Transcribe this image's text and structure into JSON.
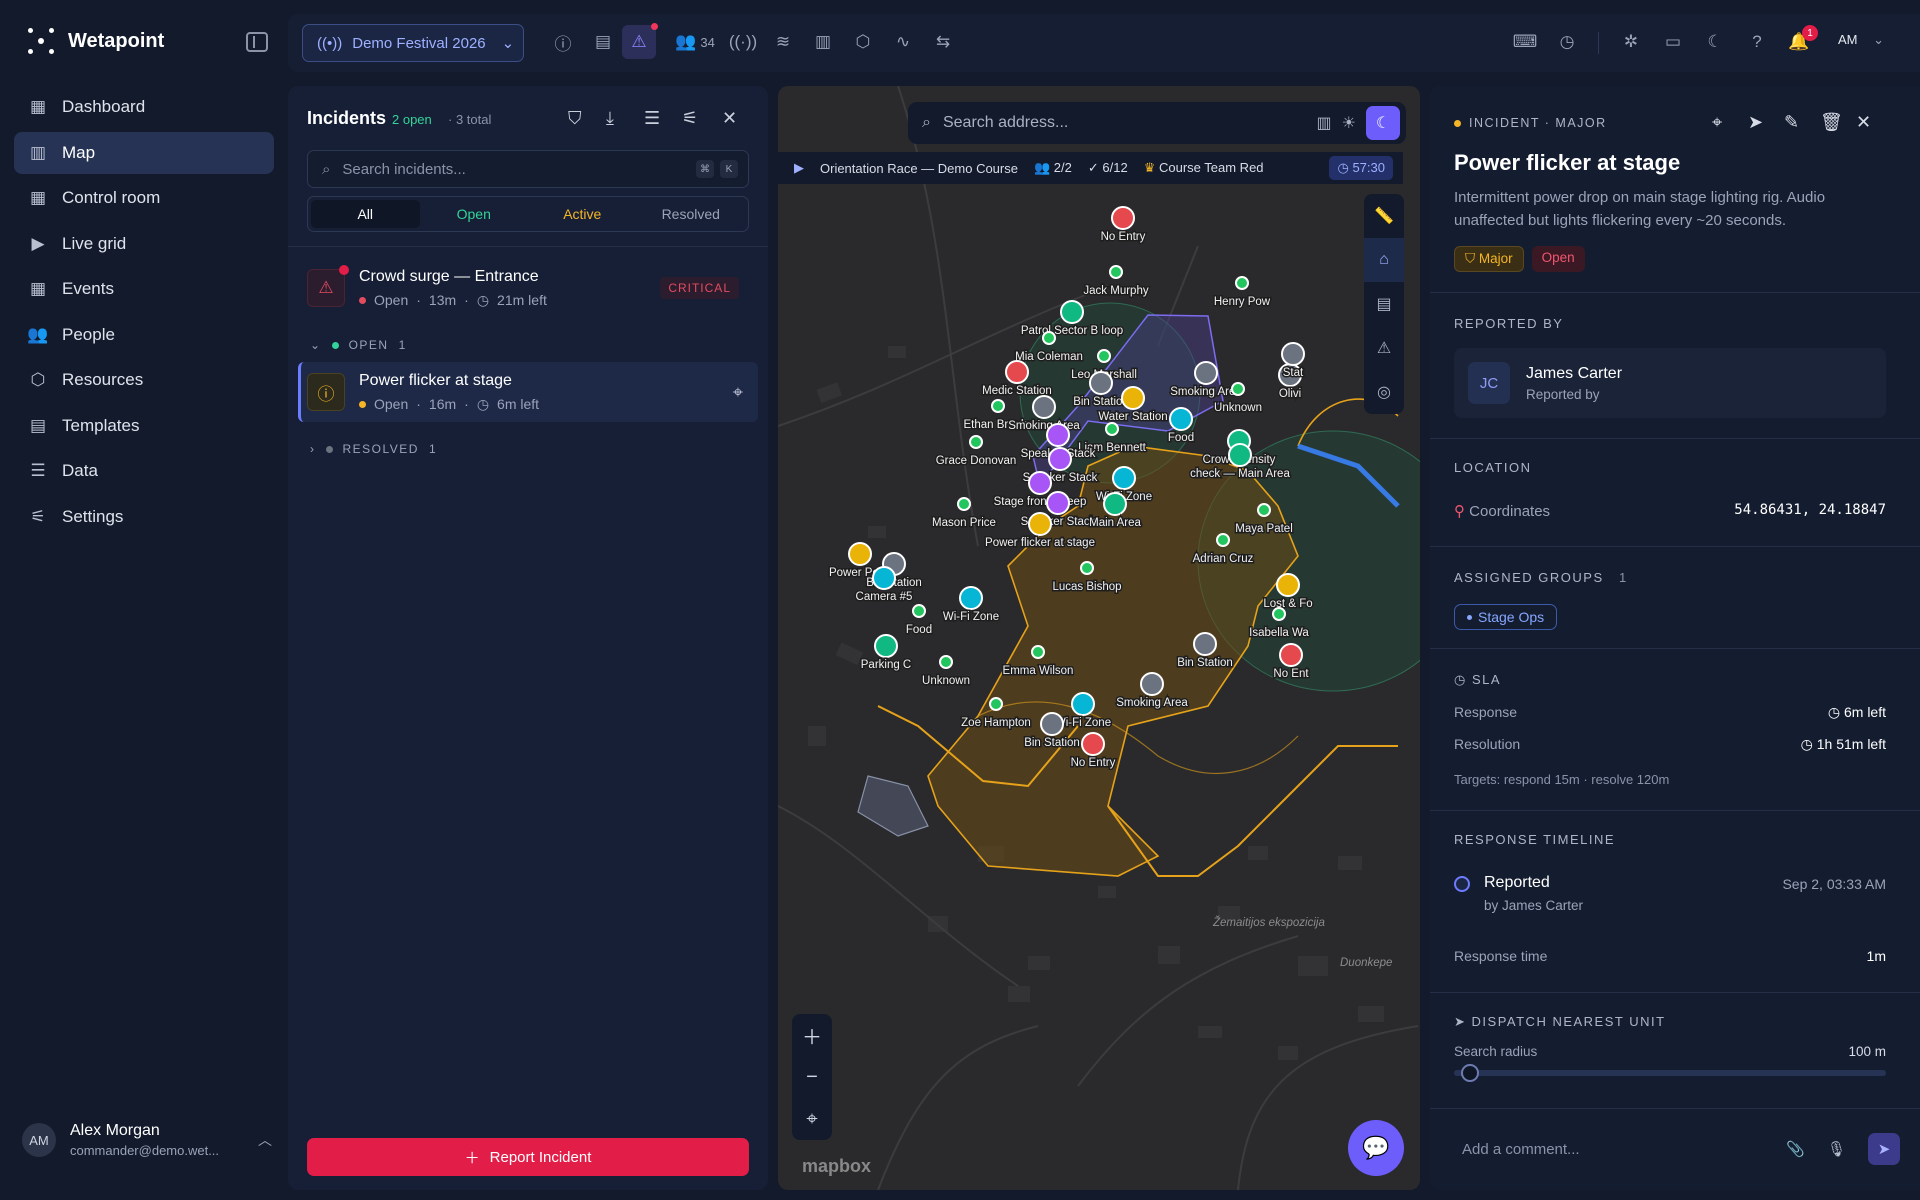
{
  "app": {
    "name": "Wetapoint"
  },
  "nav": [
    {
      "label": "Dashboard",
      "icon": "grid-icon"
    },
    {
      "label": "Map",
      "icon": "map-icon"
    },
    {
      "label": "Control room",
      "icon": "grid-icon"
    },
    {
      "label": "Live grid",
      "icon": "video-icon"
    },
    {
      "label": "Events",
      "icon": "calendar-icon"
    },
    {
      "label": "People",
      "icon": "users-icon"
    },
    {
      "label": "Resources",
      "icon": "box-icon"
    },
    {
      "label": "Templates",
      "icon": "clipboard-icon"
    },
    {
      "label": "Data",
      "icon": "database-icon"
    },
    {
      "label": "Settings",
      "icon": "sliders-icon"
    }
  ],
  "user": {
    "initials": "AM",
    "name": "Alex Morgan",
    "email": "commander@demo.wet..."
  },
  "topbar": {
    "event": "Demo Festival 2026",
    "people_count": "34",
    "notif_count": "1",
    "avatar": "AM"
  },
  "incidents": {
    "title": "Incidents",
    "open_count": "2 open",
    "total": "· 3 total",
    "search_placeholder": "Search incidents...",
    "kbd": [
      "⌘",
      "K"
    ],
    "tabs": [
      "All",
      "Open",
      "Active",
      "Resolved"
    ],
    "items": [
      {
        "title": "Crowd surge — Entrance",
        "status": "Open",
        "age": "13m",
        "sla": "21m left",
        "badge": "CRITICAL"
      },
      {
        "title": "Power flicker at stage",
        "status": "Open",
        "age": "16m",
        "sla": "6m left"
      }
    ],
    "groups": [
      {
        "label": "OPEN",
        "count": "1"
      },
      {
        "label": "RESOLVED",
        "count": "1"
      }
    ],
    "report_button": "Report Incident"
  },
  "map": {
    "search_placeholder": "Search address...",
    "race": {
      "name": "Orientation Race — Demo Course",
      "teams": "2/2",
      "checkpoints": "6/12",
      "leader": "Course Team Red",
      "timer": "57:30"
    },
    "attribution": "mapbox",
    "labels": [
      {
        "t": "No Entry",
        "c": "#e5484d"
      },
      {
        "t": "Jack Murphy",
        "c": "#22c55e"
      },
      {
        "t": "Patrol Sector B loop",
        "c": "#10b981"
      },
      {
        "t": "Mia Coleman",
        "c": "#22c55e"
      },
      {
        "t": "Leo Marshall",
        "c": "#22c55e"
      },
      {
        "t": "Medic Station",
        "c": "#e5484d"
      },
      {
        "t": "Bin Station",
        "c": "#6b7280"
      },
      {
        "t": "Ethan Brooks",
        "c": "#22c55e"
      },
      {
        "t": "Smoking Area",
        "c": "#6b7280"
      },
      {
        "t": "Water Station",
        "c": "#eab308"
      },
      {
        "t": "Liam Bennett",
        "c": "#22c55e"
      },
      {
        "t": "Smoking Area",
        "c": "#6b7280"
      },
      {
        "t": "Unknown",
        "c": "#22c55e"
      },
      {
        "t": "Food",
        "c": "#06b6d4"
      },
      {
        "t": "Crowd density",
        "c": "#10b981"
      },
      {
        "t": "check — Main Area",
        "c": "#10b981"
      },
      {
        "t": "Henry Pow",
        "c": "#22c55e"
      },
      {
        "t": "Grace Donovan",
        "c": "#22c55e"
      },
      {
        "t": "Speaker Stack",
        "c": "#a855f7"
      },
      {
        "t": "Speaker Stack",
        "c": "#a855f7"
      },
      {
        "t": "Wi-Fi Zone",
        "c": "#06b6d4"
      },
      {
        "t": "Stage front sweep",
        "c": "#a855f7"
      },
      {
        "t": "Mason Price",
        "c": "#22c55e"
      },
      {
        "t": "Speaker Stack",
        "c": "#a855f7"
      },
      {
        "t": "Main Area",
        "c": "#10b981"
      },
      {
        "t": "Power flicker at stage",
        "c": "#eab308"
      },
      {
        "t": "Maya Patel",
        "c": "#22c55e"
      },
      {
        "t": "Adrian Cruz",
        "c": "#22c55e"
      },
      {
        "t": "Power Point",
        "c": "#eab308"
      },
      {
        "t": "Bin Station",
        "c": "#6b7280"
      },
      {
        "t": "Camera #5",
        "c": "#06b6d4"
      },
      {
        "t": "Wi-Fi Zone",
        "c": "#06b6d4"
      },
      {
        "t": "Lucas Bishop",
        "c": "#22c55e"
      },
      {
        "t": "Lost & Fo",
        "c": "#eab308"
      },
      {
        "t": "Food",
        "c": "#22c55e"
      },
      {
        "t": "Isabella Wa",
        "c": "#22c55e"
      },
      {
        "t": "Parking C",
        "c": "#10b981"
      },
      {
        "t": "Unknown",
        "c": "#22c55e"
      },
      {
        "t": "Emma Wilson",
        "c": "#22c55e"
      },
      {
        "t": "Bin Station",
        "c": "#6b7280"
      },
      {
        "t": "No Ent",
        "c": "#e5484d"
      },
      {
        "t": "Smoking Area",
        "c": "#6b7280"
      },
      {
        "t": "Zoe Hampton",
        "c": "#22c55e"
      },
      {
        "t": "Wi-Fi Zone",
        "c": "#06b6d4"
      },
      {
        "t": "Bin Station",
        "c": "#6b7280"
      },
      {
        "t": "No Entry",
        "c": "#e5484d"
      },
      {
        "t": "Olivi",
        "c": "#6b7280"
      },
      {
        "t": "Stat",
        "c": "#6b7280"
      }
    ],
    "place_labels": [
      "Žemaitijos ekspozicija",
      "Duonkepe"
    ]
  },
  "detail": {
    "kicker": "INCIDENT · MAJOR",
    "title": "Power flicker at stage",
    "description": "Intermittent power drop on main stage lighting rig. Audio unaffected but lights flickering every ~20 seconds.",
    "severity": "Major",
    "status": "Open",
    "reported_by_h": "REPORTED BY",
    "reporter": {
      "initials": "JC",
      "name": "James Carter",
      "role": "Reported by"
    },
    "location_h": "LOCATION",
    "location_label": "Coordinates",
    "coords": "54.86431, 24.18847",
    "groups_h": "ASSIGNED GROUPS",
    "groups_count": "1",
    "group": "Stage Ops",
    "sla_h": "SLA",
    "response_label": "Response",
    "response_val": "6m left",
    "resolution_label": "Resolution",
    "resolution_val": "1h 51m left",
    "targets": "Targets: respond 15m · resolve 120m",
    "timeline_h": "RESPONSE TIMELINE",
    "timeline_event": "Reported",
    "timeline_by": "by James Carter",
    "timeline_time": "Sep 2, 03:33 AM",
    "response_time_label": "Response time",
    "response_time_val": "1m",
    "dispatch_h": "DISPATCH NEAREST UNIT",
    "radius_label": "Search radius",
    "radius_val": "100 m",
    "radius_fraction": 0.02,
    "comment_placeholder": "Add a comment..."
  }
}
